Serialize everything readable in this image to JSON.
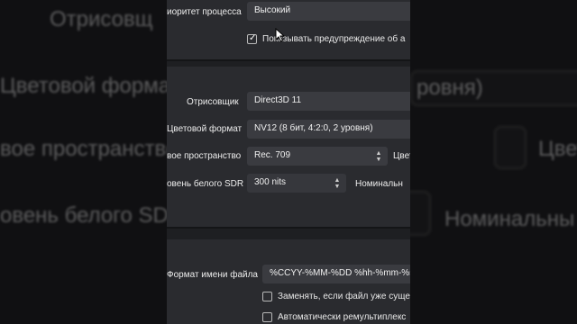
{
  "background": {
    "texts": [
      "Отрисовщ",
      "Цветовой форма",
      "ровня)",
      "вое пространство",
      "Цвет",
      "овень белого SD",
      "Номинальны"
    ]
  },
  "panel": {
    "process_priority": {
      "label": "иоритет процесса",
      "value": "Высокий"
    },
    "warn_checkbox": {
      "label": "Показывать предупреждение об а",
      "checked": true
    },
    "renderer": {
      "label": "Отрисовщик",
      "value": "Direct3D 11"
    },
    "color_format": {
      "label": "Цветовой формат",
      "value": "NV12 (8 бит, 4:2:0, 2 уровня)"
    },
    "color_space": {
      "label": "вое пространство",
      "value": "Rec. 709",
      "side_label": "Цвет"
    },
    "sdr_white": {
      "label": "овень белого SDR",
      "value": "300 nits",
      "side_label": "Номинальн"
    },
    "filename_format": {
      "label": "Формат имени файла",
      "value": "%CCYY-%MM-%DD %hh-%mm-%ss"
    },
    "overwrite_checkbox": {
      "label": "Заменять, если файл уже суще",
      "checked": false
    },
    "remux_checkbox": {
      "label": "Автоматически ремультиплекс",
      "checked": false
    }
  },
  "colors": {
    "panel_bg": "#1e1f22",
    "section_bg": "#2a2b2f",
    "field_bg": "#3a3b40",
    "text": "#ececec"
  }
}
